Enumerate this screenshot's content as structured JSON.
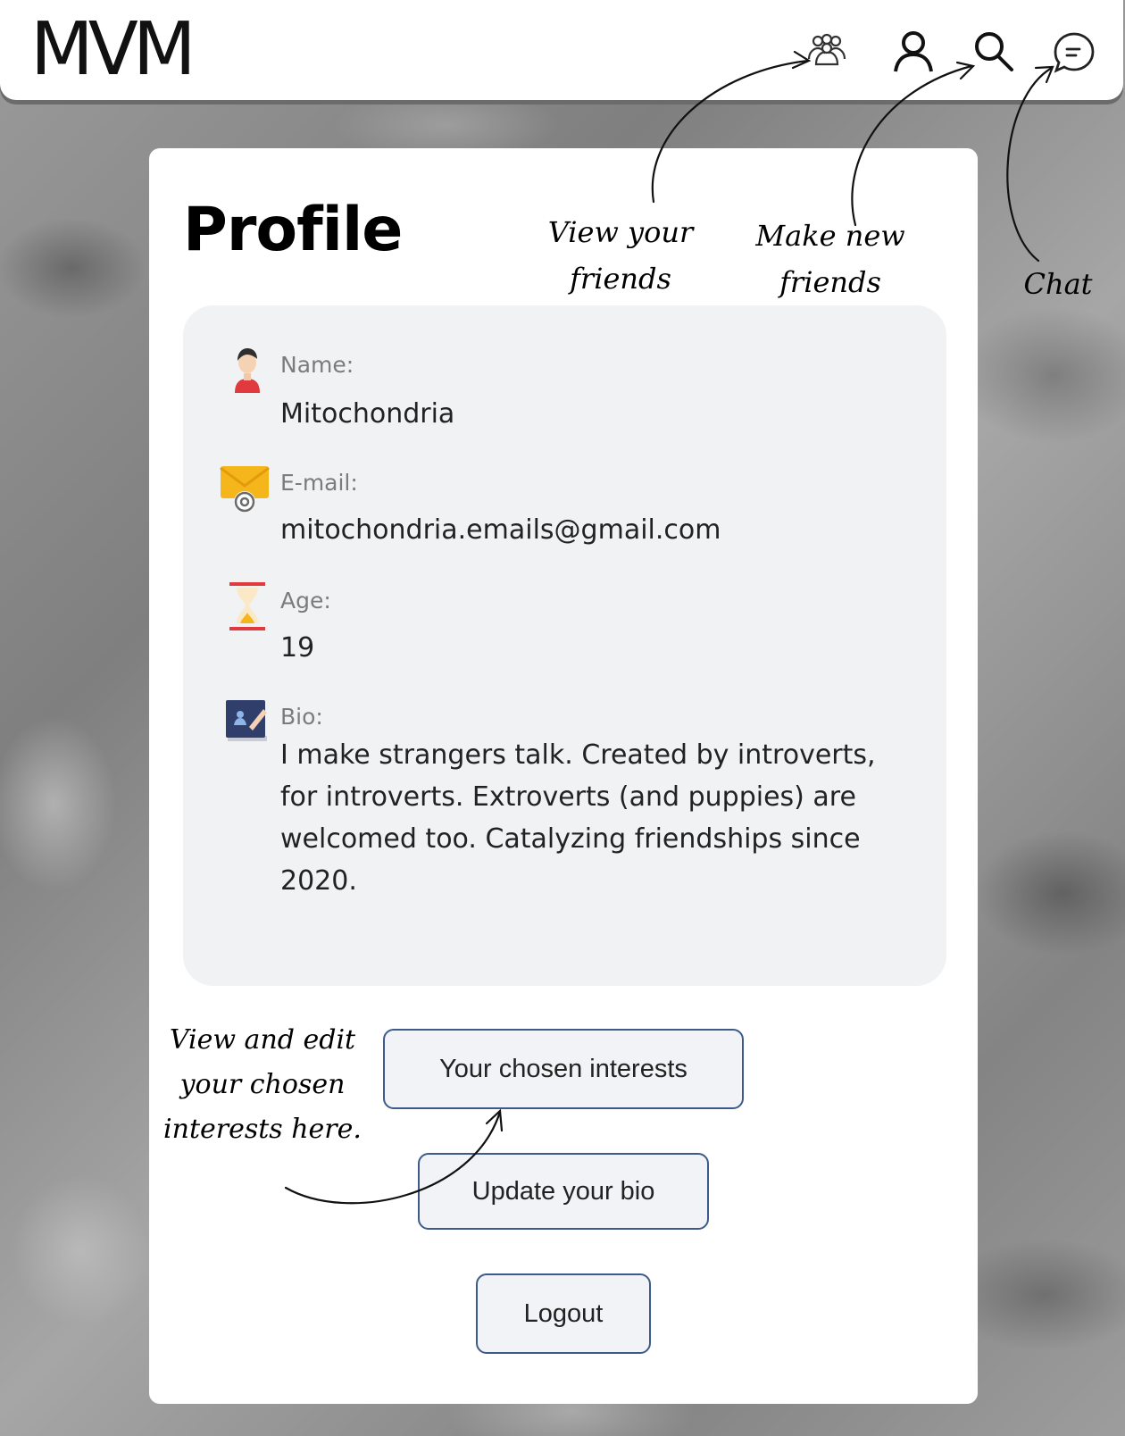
{
  "header": {
    "logo": "MVM",
    "nav": {
      "friends_icon": "people-group-icon",
      "profile_icon": "user-icon",
      "search_icon": "magnifier-icon",
      "chat_icon": "chat-bubble-icon"
    }
  },
  "profile": {
    "title": "Profile",
    "fields": [
      {
        "label": "Name:",
        "value": "Mitochondria",
        "icon": "person-icon"
      },
      {
        "label": "E-mail:",
        "value": "mitochondria.emails@gmail.com",
        "icon": "envelope-icon"
      },
      {
        "label": "Age:",
        "value": "19",
        "icon": "hourglass-icon"
      },
      {
        "label": "Bio:",
        "value": "I make strangers talk. Created by introverts, for introverts. Extroverts (and puppies) are welcomed too. Catalyzing friendships since 2020.",
        "icon": "notebook-icon"
      }
    ]
  },
  "buttons": {
    "interests": "Your chosen interests",
    "update_bio": "Update your bio",
    "logout": "Logout"
  },
  "annotations": {
    "view_friends_line1": "View your",
    "view_friends_line2": "friends",
    "make_friends_line1": "Make new",
    "make_friends_line2": "friends",
    "chat": "Chat",
    "interests_line1": "View and edit",
    "interests_line2": "your chosen",
    "interests_line3": "interests here."
  },
  "colors": {
    "button_border": "#3d5a8a",
    "info_box": "#f1f2f4",
    "icon_red": "#e0393e",
    "icon_yellow": "#f5b61c",
    "icon_navy": "#2f3e6b"
  }
}
